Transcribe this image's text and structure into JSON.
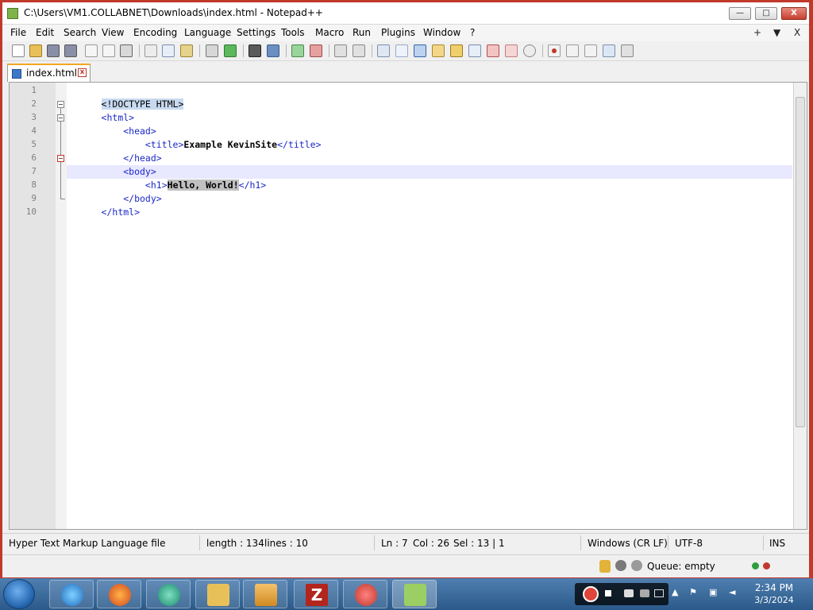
{
  "window": {
    "title": "C:\\Users\\VM1.COLLABNET\\Downloads\\index.html - Notepad++",
    "minimize_glyph": "—",
    "maximize_glyph": "□",
    "close_glyph": "X"
  },
  "menu": {
    "items": [
      "File",
      "Edit",
      "Search",
      "View",
      "Encoding",
      "Language",
      "Settings",
      "Tools",
      "Macro",
      "Run",
      "Plugins",
      "Window",
      "?"
    ],
    "right": [
      "+",
      "▼",
      "X"
    ]
  },
  "tab": {
    "label": "index.html",
    "close_glyph": "x"
  },
  "editor": {
    "line_numbers": [
      "1",
      "2",
      "3",
      "4",
      "5",
      "6",
      "7",
      "8",
      "9",
      "10"
    ],
    "lines": [
      {
        "p1": "<!DOCTYPE HTML>"
      },
      {
        "p1": "<html>"
      },
      {
        "p1": "    <head>"
      },
      {
        "p1": "        <title>",
        "p2": "Example KevinSite",
        "p3": "</title>"
      },
      {
        "p1": "    </head>"
      },
      {
        "p1": "    <body>"
      },
      {
        "p1": "        <h1>",
        "p2": "Hello, World!",
        "p3": "</h1>"
      },
      {
        "p1": "    </body>"
      },
      {
        "p1": "</html>"
      }
    ]
  },
  "status": {
    "file_type": "Hyper Text Markup Language file",
    "length": "length : 134",
    "lines": "lines : 10",
    "ln": "Ln : 7",
    "col": "Col : 26",
    "sel": "Sel : 13 | 1",
    "eol": "Windows (CR LF)",
    "encoding": "UTF-8",
    "mode": "INS"
  },
  "filezilla": {
    "queue": "Queue: empty"
  },
  "taskbar": {
    "time": "2:34 PM",
    "date": "3/3/2024"
  },
  "colors": {
    "tag": "#1a28c8",
    "accent_tab": "#f5a623",
    "taskbar": "#2b5a8a"
  }
}
